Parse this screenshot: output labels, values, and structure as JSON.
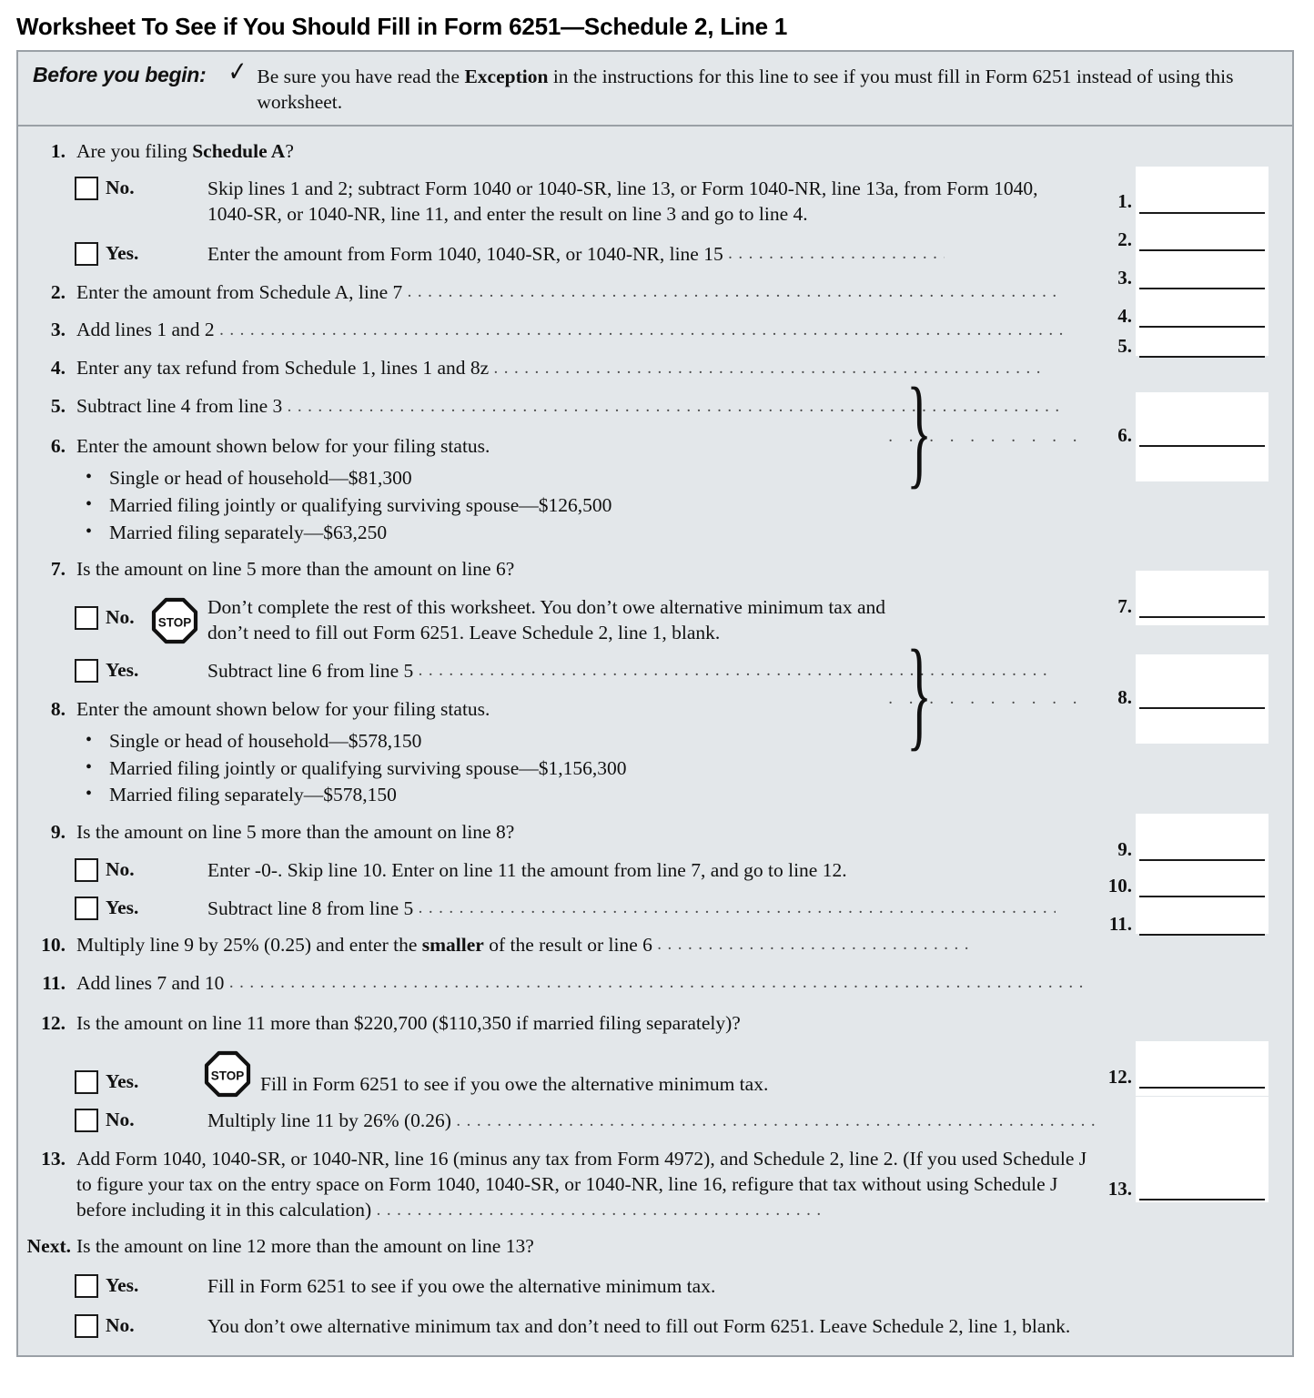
{
  "page_title": "Worksheet To See if You Should Fill in Form 6251—Schedule 2, Line 1",
  "before_you_begin": {
    "label": "Before you begin:",
    "check_icon": "checkmark-icon",
    "text_part1": "Be sure you have read the ",
    "text_bold": "Exception",
    "text_part2": " in the instructions for this line to see if you must fill in Form 6251 instead of using this worksheet."
  },
  "line1": {
    "number": "1.",
    "question_part1": "Are you filing ",
    "question_bold": "Schedule A",
    "question_part2": "?",
    "no_label": "No.",
    "no_text": "Skip lines 1 and 2; subtract Form 1040 or 1040-SR, line 13, or Form 1040-NR, line 13a, from Form 1040, 1040-SR, or 1040-NR, line 11, and enter the result on line 3 and go to line 4.",
    "yes_label": "Yes.",
    "yes_text": "Enter the amount from Form 1040, 1040-SR, or 1040-NR, line 15",
    "answer_number": "1."
  },
  "line2": {
    "number": "2.",
    "text": "Enter the amount from Schedule A, line 7",
    "answer_number": "2."
  },
  "line3": {
    "number": "3.",
    "text": "Add lines 1 and 2",
    "answer_number": "3."
  },
  "line4": {
    "number": "4.",
    "text": "Enter any tax refund from Schedule 1, lines 1 and 8z",
    "answer_number": "4."
  },
  "line5": {
    "number": "5.",
    "text": "Subtract line 4 from line 3",
    "answer_number": "5."
  },
  "line6": {
    "number": "6.",
    "text": "Enter the amount shown below for your filing status.",
    "bullets": [
      "Single or head of household—$81,300",
      "Married filing jointly or qualifying surviving spouse—$126,500",
      "Married filing separately—$63,250"
    ],
    "answer_number": "6."
  },
  "line7": {
    "number": "7.",
    "question": "Is the amount on line 5 more than the amount on line 6?",
    "no_label": "No.",
    "no_icon": "stop-sign-icon",
    "no_text": "Don’t complete the rest of this worksheet. You don’t owe alternative minimum tax and don’t need to fill out Form 6251. Leave Schedule 2, line 1, blank.",
    "yes_label": "Yes.",
    "yes_text": "Subtract line 6 from line 5",
    "answer_number": "7."
  },
  "line8": {
    "number": "8.",
    "text": "Enter the amount shown below for your filing status.",
    "bullets": [
      "Single or head of household—$578,150",
      "Married filing jointly or qualifying surviving spouse—$1,156,300",
      "Married filing separately—$578,150"
    ],
    "answer_number": "8."
  },
  "line9": {
    "number": "9.",
    "question": "Is the amount on line 5 more than the amount on line 8?",
    "no_label": "No.",
    "no_text": "Enter -0-. Skip line 10. Enter on line 11 the amount from line 7, and go to line 12.",
    "yes_label": "Yes.",
    "yes_text": "Subtract line 8 from line 5",
    "answer_number": "9."
  },
  "line10": {
    "number": "10.",
    "text_part1": "Multiply line 9 by 25% (0.25) and enter the ",
    "text_bold": "smaller",
    "text_part2": " of the result or line 6",
    "answer_number": "10."
  },
  "line11": {
    "number": "11.",
    "text": "Add lines 7 and 10",
    "answer_number": "11."
  },
  "line12": {
    "number": "12.",
    "question": "Is the amount on line 11 more than $220,700 ($110,350 if married filing separately)?",
    "yes_label": "Yes.",
    "yes_icon": "stop-sign-icon",
    "yes_text": "Fill in Form 6251 to see if you owe the alternative minimum tax.",
    "no_label": "No.",
    "no_text": "Multiply line 11 by 26% (0.26)",
    "answer_number": "12."
  },
  "line13": {
    "number": "13.",
    "text": "Add Form 1040, 1040-SR, or 1040-NR, line 16 (minus any tax from Form 4972), and Schedule 2, line 2. (If you used Schedule J to figure your tax on the entry space on Form 1040, 1040-SR, or 1040-NR, line 16, refigure that tax without using Schedule J before including it in this calculation)",
    "answer_number": "13."
  },
  "next": {
    "number": "Next.",
    "question": "Is the amount on line 12 more than the amount on line 13?",
    "yes_label": "Yes.",
    "yes_text": "Fill in Form 6251 to see if you owe the alternative minimum tax.",
    "no_label": "No.",
    "no_text": "You don’t owe alternative minimum tax and don’t need to fill out Form 6251. Leave Schedule 2, line 1, blank."
  },
  "stop_sign_text": "STOP",
  "colors": {
    "worksheet_background": "#e3e7ea",
    "worksheet_border": "#9aa0a6",
    "text": "#111111",
    "answer_box": "#ffffff"
  }
}
